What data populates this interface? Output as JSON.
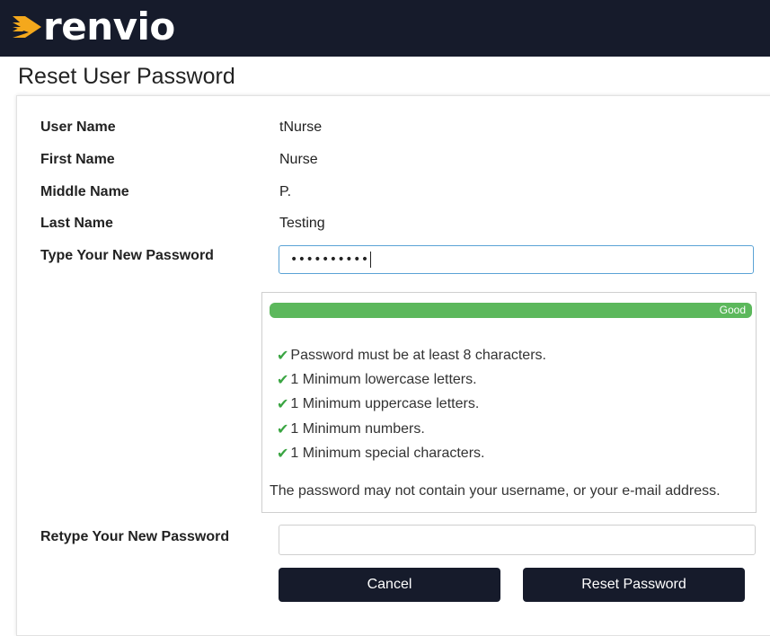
{
  "brand": {
    "name": "renvio",
    "accent": "#f4a81c",
    "header_bg": "#161b2b"
  },
  "page": {
    "title": "Reset User Password"
  },
  "user": {
    "fields": [
      {
        "label": "User Name",
        "value": "tNurse"
      },
      {
        "label": "First Name",
        "value": "Nurse"
      },
      {
        "label": "Middle Name",
        "value": "P."
      },
      {
        "label": "Last Name",
        "value": "Testing"
      }
    ]
  },
  "new_password": {
    "label": "Type Your New Password",
    "masked_value": "••••••••••"
  },
  "strength": {
    "label": "Good",
    "level": 1.0,
    "color": "#5cb85c"
  },
  "rules": {
    "items": [
      {
        "icon": "check-icon",
        "text": "Password must be at least 8 characters."
      },
      {
        "icon": "check-icon",
        "text": "1 Minimum lowercase letters."
      },
      {
        "icon": "check-icon",
        "text": "1 Minimum uppercase letters."
      },
      {
        "icon": "check-icon",
        "text": "1 Minimum numbers."
      },
      {
        "icon": "check-icon",
        "text": "1 Minimum special characters."
      }
    ],
    "note": "The password may not contain your username, or your e-mail address."
  },
  "retype_password": {
    "label": "Retype Your New Password",
    "value": ""
  },
  "actions": {
    "cancel_label": "Cancel",
    "reset_label": "Reset Password"
  }
}
